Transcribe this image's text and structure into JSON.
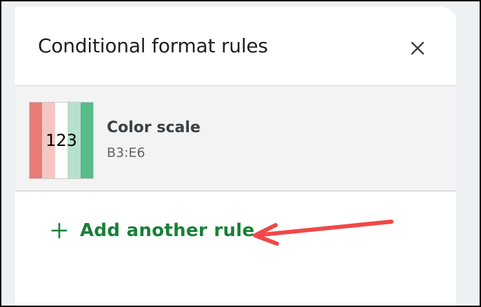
{
  "panel": {
    "title": "Conditional format rules",
    "close_icon": "close-icon"
  },
  "rule": {
    "preview_text": "123",
    "preview_colors": [
      "#e67c73",
      "#f4c7c3",
      "#ffffff",
      "#b7e1cd",
      "#57bb8a"
    ],
    "type": "Color scale",
    "range": "B3:E6"
  },
  "add_rule": {
    "icon": "plus-icon",
    "label": "Add another rule"
  },
  "annotation": {
    "icon": "red-arrow-icon",
    "color": "#f04848"
  },
  "colors": {
    "accent_green": "#188038",
    "card_bg": "#f3f3f3"
  }
}
